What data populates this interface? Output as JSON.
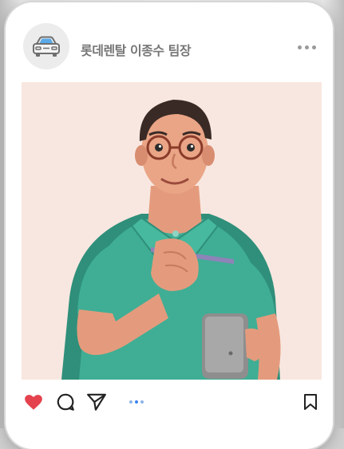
{
  "post": {
    "username": "롯데렌탈 이종수 팀장",
    "image_alt": "",
    "liked": true
  },
  "icons": {
    "avatar": "car-icon",
    "more": "more-horizontal-icon",
    "like": "heart-icon",
    "comment": "comment-icon",
    "share": "send-icon",
    "carousel": "carousel-dots-icon",
    "save": "bookmark-icon"
  },
  "colors": {
    "heart": "#e4424d",
    "carousel_dot": "#3b82f6",
    "image_bg": "#f8e7e0",
    "shirt": "#3fae94"
  }
}
